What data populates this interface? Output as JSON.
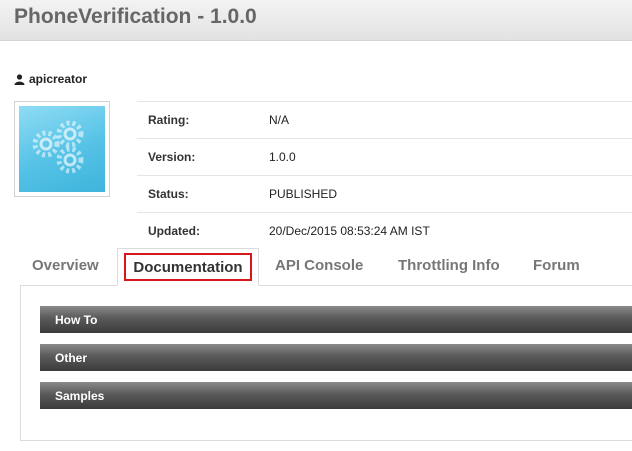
{
  "header": {
    "title": "PhoneVerification - 1.0.0"
  },
  "creator": {
    "name": "apicreator"
  },
  "details": [
    {
      "label": "Rating:",
      "value": "N/A"
    },
    {
      "label": "Version:",
      "value": "1.0.0"
    },
    {
      "label": "Status:",
      "value": "PUBLISHED"
    },
    {
      "label": "Updated:",
      "value": "20/Dec/2015 08:53:24 AM IST"
    }
  ],
  "tabs": [
    {
      "label": "Overview"
    },
    {
      "label": "Documentation",
      "active": true
    },
    {
      "label": "API Console"
    },
    {
      "label": "Throttling Info"
    },
    {
      "label": "Forum"
    }
  ],
  "documentation": {
    "sections": [
      {
        "label": "How To"
      },
      {
        "label": "Other"
      },
      {
        "label": "Samples"
      }
    ]
  },
  "colors": {
    "highlight": "#d8171b",
    "thumbnail": "#55c2e6",
    "section_bar": "#4a4a4a"
  }
}
